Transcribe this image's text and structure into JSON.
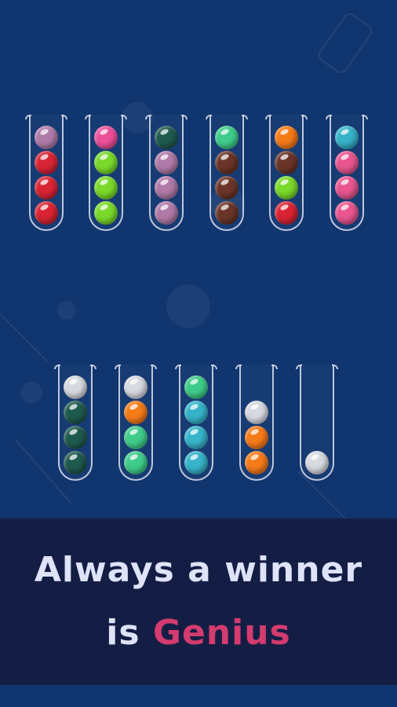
{
  "colors": {
    "background": "#10356f",
    "banner": "#141e45",
    "text": "#dfe3f7",
    "accent": "#d43b6e"
  },
  "ball_colors": {
    "purple": "#b07aa8",
    "red": "#d92434",
    "pink": "#ec4f9a",
    "lime": "#7ad92a",
    "darkteal": "#1f5a4e",
    "mint": "#3fcc8a",
    "brown": "#6a3528",
    "orange": "#f57a18",
    "cyan": "#36b3c9",
    "hotpink": "#e8558f",
    "white": "#d7d9e0"
  },
  "tubes_top": [
    [
      "purple",
      "red",
      "red",
      "red"
    ],
    [
      "pink",
      "lime",
      "lime",
      "lime"
    ],
    [
      "darkteal",
      "purple",
      "purple",
      "purple"
    ],
    [
      "mint",
      "brown",
      "brown",
      "brown"
    ],
    [
      "orange",
      "brown",
      "lime",
      "red"
    ],
    [
      "cyan",
      "hotpink",
      "hotpink",
      "hotpink"
    ]
  ],
  "tubes_bottom": [
    [
      "white",
      "darkteal",
      "darkteal",
      "darkteal"
    ],
    [
      "white",
      "orange",
      "mint",
      "mint"
    ],
    [
      "mint",
      "cyan",
      "cyan",
      "cyan"
    ],
    [
      "white",
      "orange",
      "orange"
    ],
    [
      "white"
    ]
  ],
  "tagline": {
    "line1": "Always a winner",
    "line2_prefix": "is ",
    "line2_accent": "Genius"
  }
}
